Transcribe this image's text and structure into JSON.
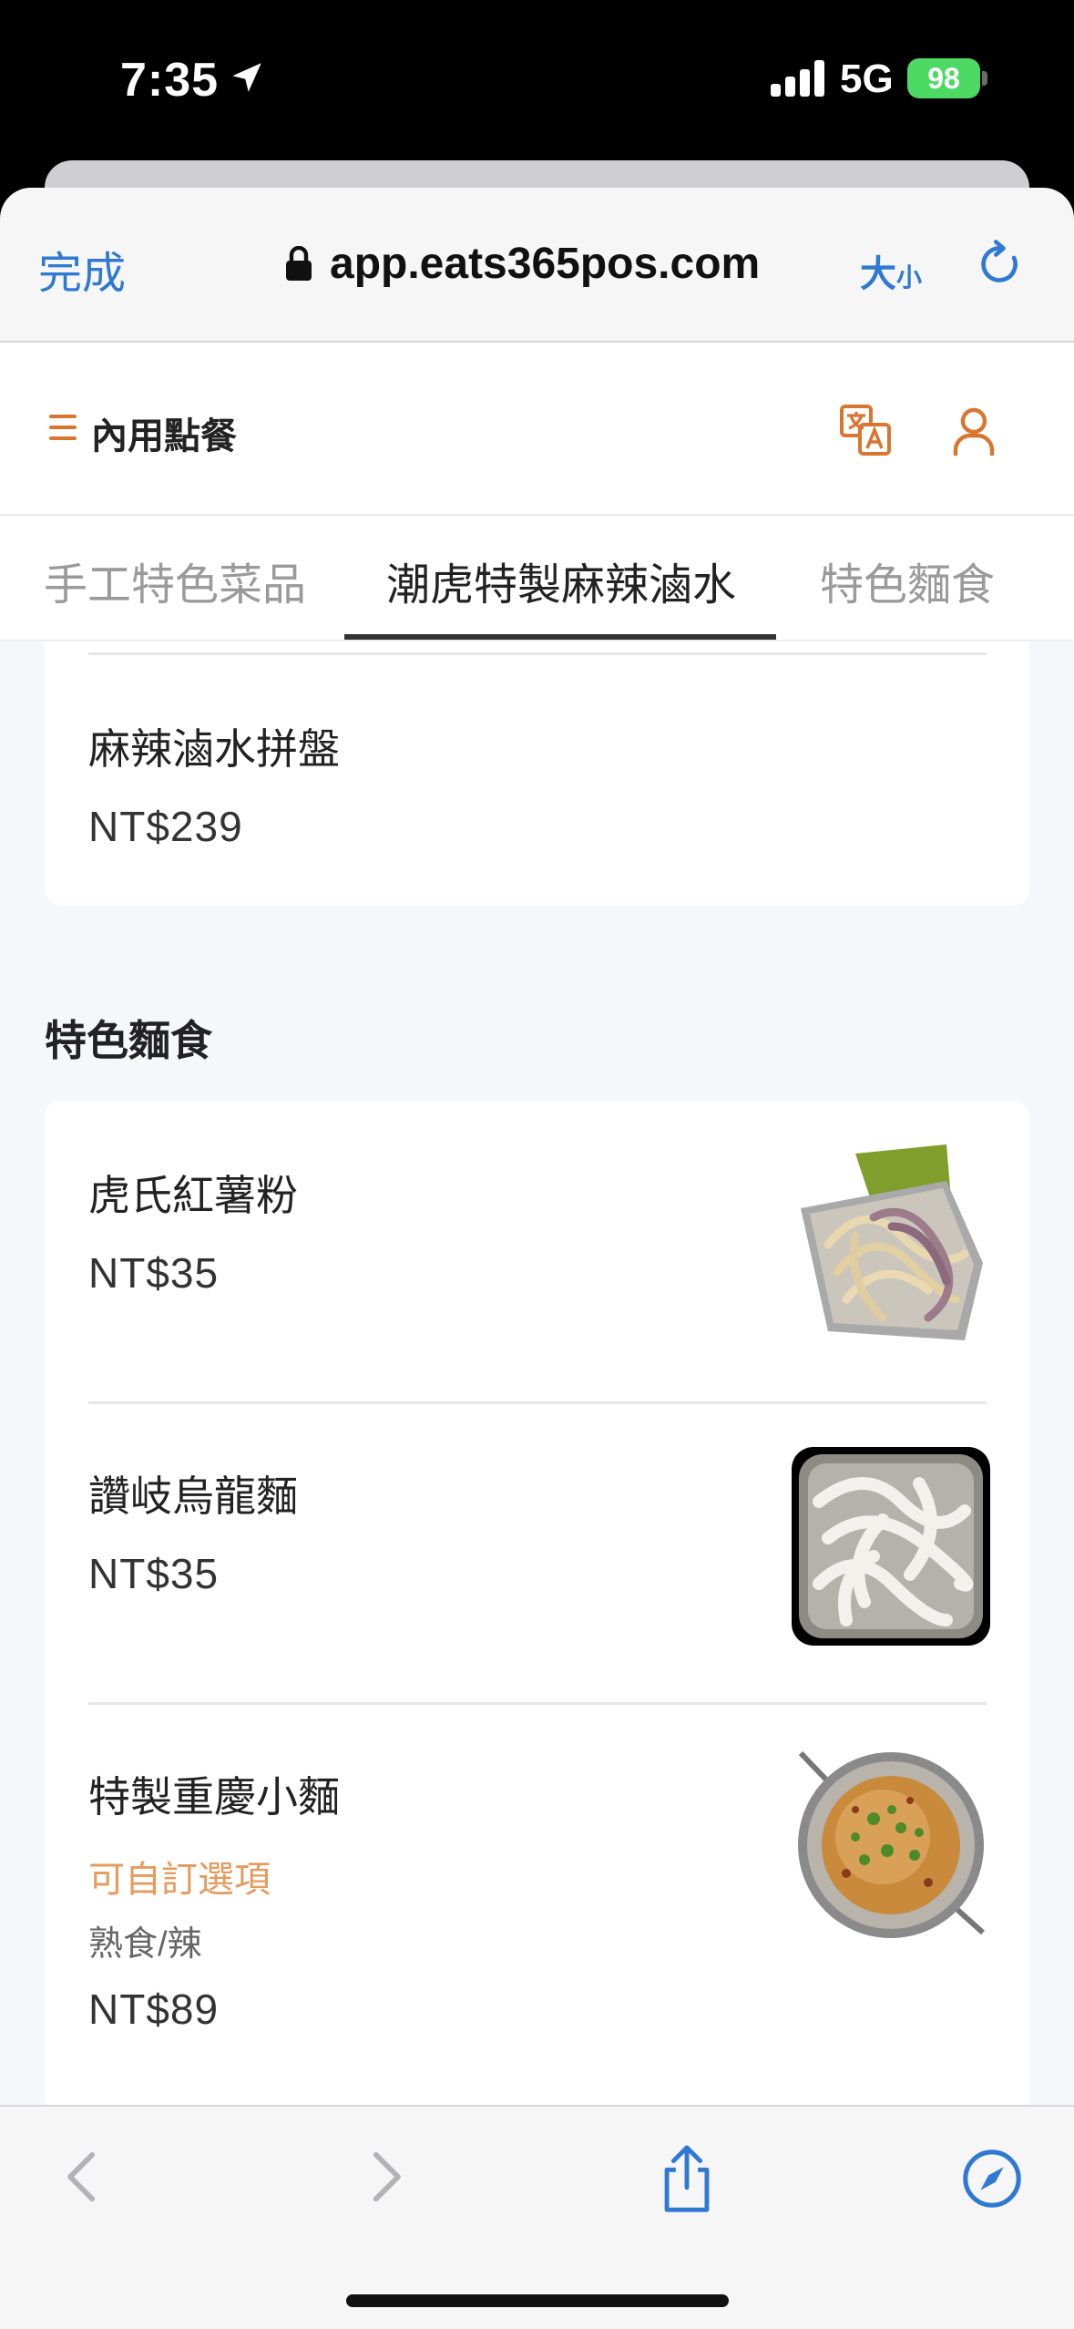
{
  "status_bar": {
    "time": "7:35",
    "network": "5G",
    "battery": "98"
  },
  "browser": {
    "done": "完成",
    "url": "app.eats365pos.com",
    "size_big": "大",
    "size_small": "小"
  },
  "app": {
    "title": "內用點餐"
  },
  "tabs": [
    {
      "label": "手工特色菜品",
      "active": false
    },
    {
      "label": "潮虎特製麻辣滷水",
      "active": true
    },
    {
      "label": "特色麵食",
      "active": false
    }
  ],
  "top_card": {
    "name": "麻辣滷水拼盤",
    "price": "NT$239"
  },
  "section": {
    "title": "特色麵食",
    "items": [
      {
        "name": "虎氏紅薯粉",
        "price": "NT$35"
      },
      {
        "name": "讚岐烏龍麵",
        "price": "NT$35"
      },
      {
        "name": "特製重慶小麵",
        "custom": "可自訂選項",
        "desc": "熟食/辣",
        "price": "NT$89"
      }
    ]
  },
  "colors": {
    "accent": "#d8762f",
    "link": "#2f79d4",
    "custom_text": "#e49b5d"
  },
  "icons": [
    "location-arrow-icon",
    "lock-icon",
    "reload-icon",
    "menu-icon",
    "translate-icon",
    "user-icon",
    "back-icon",
    "forward-icon",
    "share-icon",
    "compass-icon"
  ]
}
